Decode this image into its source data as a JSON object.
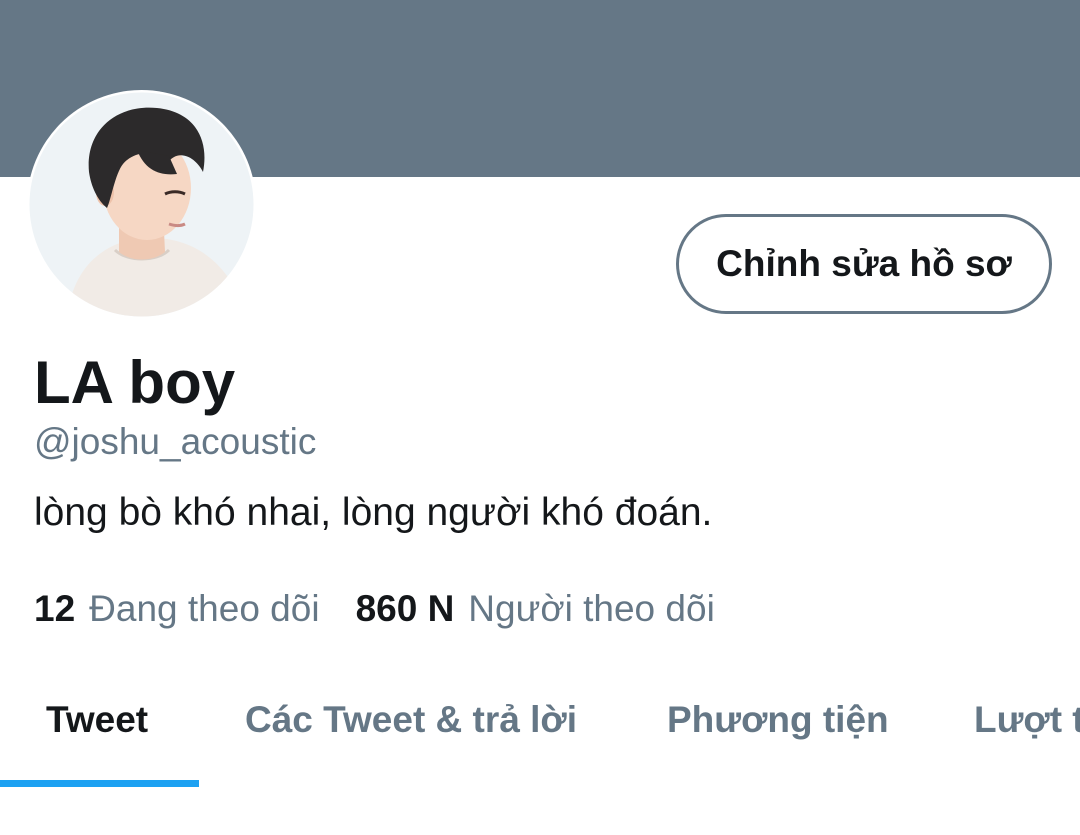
{
  "profile": {
    "banner_color": "#657786",
    "avatar": "profile-photo",
    "edit_button_label": "Chỉnh sửa hồ sơ",
    "display_name": "LA boy",
    "handle": "@joshu_acoustic",
    "bio": "lòng bò khó nhai, lòng người khó đoán.",
    "following_count": "12",
    "following_label": "Đang theo dõi",
    "followers_count": "860 N",
    "followers_label": "Người theo dõi"
  },
  "tabs": [
    {
      "label": "Tweet",
      "active": true
    },
    {
      "label": "Các Tweet & trả lời",
      "active": false
    },
    {
      "label": "Phương tiện",
      "active": false
    },
    {
      "label": "Lượt thích",
      "active": false
    }
  ],
  "colors": {
    "accent": "#1da1f2",
    "secondary_text": "#657786",
    "primary_text": "#14171a"
  }
}
